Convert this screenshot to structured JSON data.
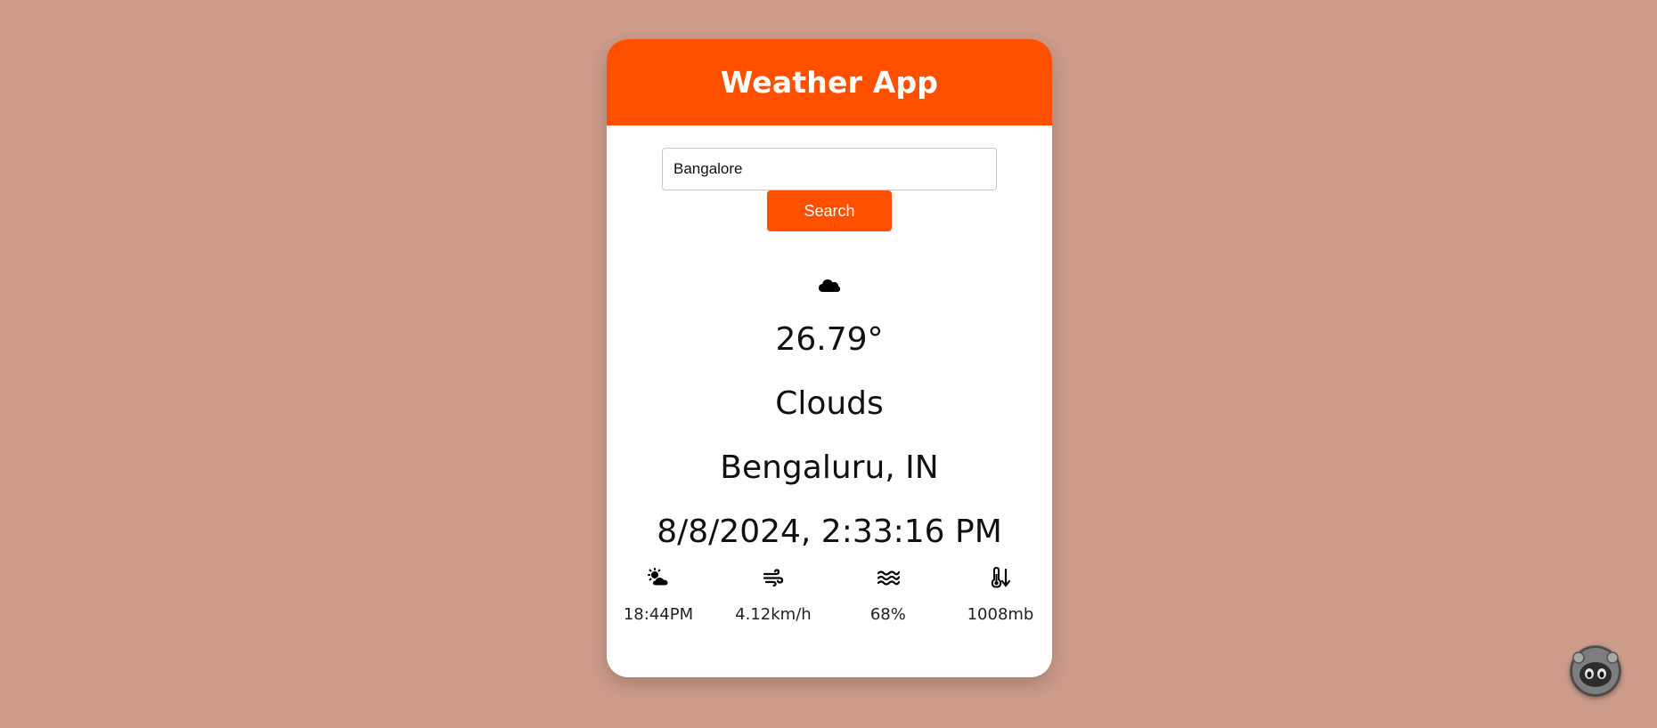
{
  "app": {
    "title": "Weather App"
  },
  "search": {
    "value": "Bangalore",
    "button_label": "Search"
  },
  "weather": {
    "icon": "cloud-icon",
    "temperature": "26.79°",
    "description": "Clouds",
    "location": "Bengaluru, IN",
    "datetime": "8/8/2024, 2:33:16 PM"
  },
  "stats": [
    {
      "icon": "sun-behind-cloud-icon",
      "value": "18:44PM"
    },
    {
      "icon": "wind-icon",
      "value": "4.12km/h"
    },
    {
      "icon": "water-waves-icon",
      "value": "68%"
    },
    {
      "icon": "thermometer-down-icon",
      "value": "1008mb"
    }
  ],
  "colors": {
    "background": "#cc9b8a",
    "accent": "#ff5000",
    "card": "#ffffff"
  },
  "avatar": {
    "icon": "robot-avatar-icon"
  }
}
